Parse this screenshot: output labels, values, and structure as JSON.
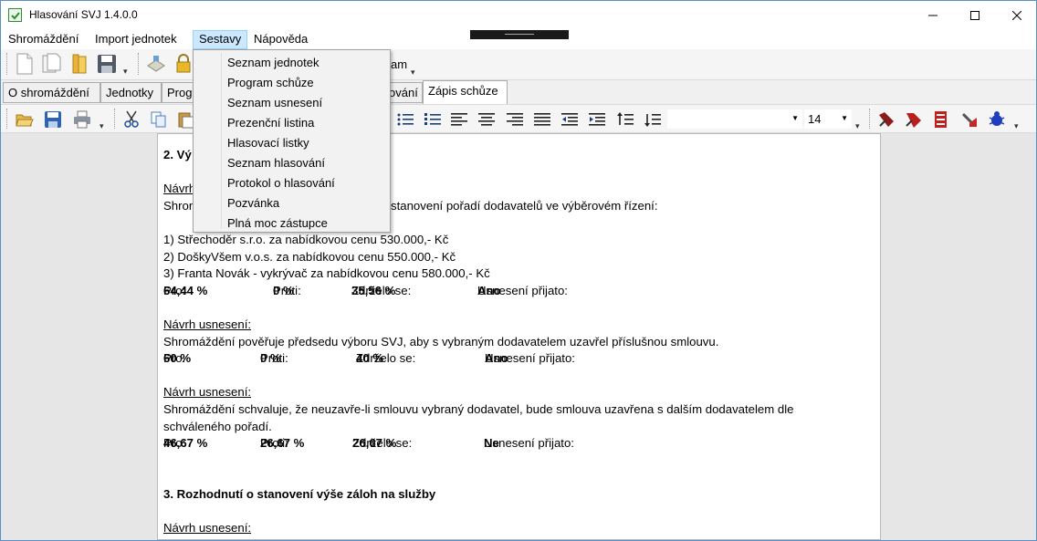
{
  "window": {
    "title": "Hlasování SVJ 1.4.0.0"
  },
  "menubar": {
    "items": [
      "Shromáždění",
      "Import jednotek",
      "Sestavy",
      "Nápověda"
    ]
  },
  "toolbar": {
    "partial_label": "am"
  },
  "tabs": {
    "items": [
      "O shromáždění",
      "Jednotky",
      "Prog",
      "ování",
      "Zápis schůze"
    ],
    "active": "Zápis schůze"
  },
  "editor_toolbar": {
    "font_size": "14",
    "style": ""
  },
  "dropdown": {
    "items": [
      "Seznam jednotek",
      "Program schůze",
      "Seznam usnesení",
      "Prezenční listina",
      "Hlasovací listky",
      "Seznam hlasování",
      "Protokol o hlasování",
      "Pozvánka",
      "Plná moc zástupce"
    ]
  },
  "document": {
    "heading2": "2. Vý",
    "proposal_partial": "Návrh",
    "line_a_left": "Shrom",
    "line_a_right": "stanovení pořadí dodavatelů ve výběrovém řízení:",
    "list": [
      "1) Střechoděr s.r.o. za nabídkovou cenu 530.000,- Kč",
      "2) DoškyVšem v.o.s. za nabídkovou cenu 550.000,- Kč",
      "3) Franta Novák - vykrývač za nabídkovou cenu 580.000,- Kč"
    ],
    "vote1": {
      "pro_l": "Pro: ",
      "pro": "64,44 %",
      "proti_l": "Proti: ",
      "proti": "0 %",
      "zdrz_l": "Zdrželo se: ",
      "zdrz": "35,56 %",
      "res_l": "Usnesení přijato: ",
      "res": "Ano"
    },
    "proposal_label": "Návrh usnesení:",
    "text2": "Shromáždění pověřuje předsedu výboru SVJ, aby s vybraným dodavatelem uzavřel příslušnou smlouvu.",
    "vote2": {
      "pro_l": "Pro: ",
      "pro": "60 %",
      "proti_l": "Proti: ",
      "proti": "0 %",
      "zdrz_l": "Zdrželo se: ",
      "zdrz": "40 %",
      "res_l": "Usnesení přijato: ",
      "res": "Ano"
    },
    "text3a": "Shromáždění schvaluje, že neuzavře-li smlouvu vybraný dodavatel, bude smlouva uzavřena s dalším dodavatelem dle",
    "text3b": "schváleného pořadí.",
    "vote3": {
      "pro_l": "Pro: ",
      "pro": "46,67 %",
      "proti_l": "Proti: ",
      "proti": "26,67 %",
      "zdrz_l": "Zdrželo se: ",
      "zdrz": "26,67 %",
      "res_l": "Usnesení přijato: ",
      "res": "Ne"
    },
    "heading3": "3. Rozhodnutí o stanovení výše záloh na služby"
  }
}
